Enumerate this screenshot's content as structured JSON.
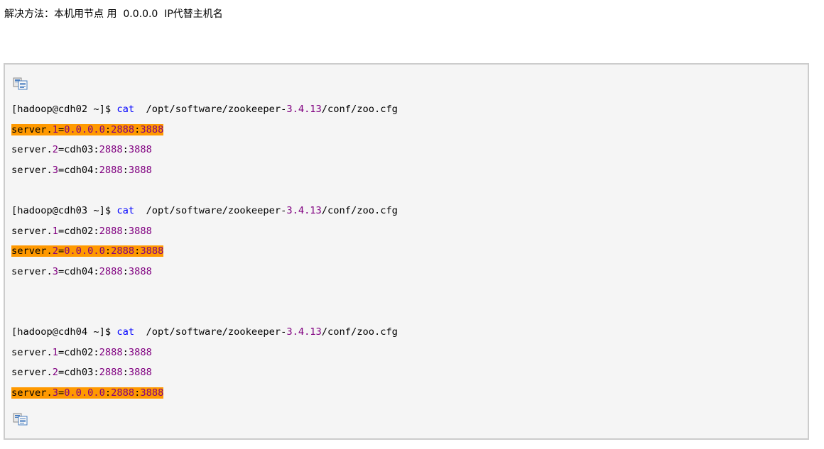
{
  "intro": "解决方法：本机用节点 用  0.0.0.0  IP代替主机名",
  "copy_icon": {
    "name": "copy-code-icon",
    "colors": [
      "#4a7fc1",
      "#c0c0c0"
    ]
  },
  "colors": {
    "highlight": "#ff9900",
    "keyword": "#0000ff",
    "number": "#800080",
    "box_bg": "#f5f5f5",
    "box_border": "#cccccc"
  },
  "lines": [
    {
      "prompt": "[hadoop@cdh02 ~]$ ",
      "cmd": "cat",
      "path_a": "  /opt/software/zookeeper-",
      "ver": "3.4.13",
      "path_b": "/conf/zoo.cfg"
    },
    {
      "s_a": "server.",
      "idx": "1",
      "s_b": "=",
      "host": "0.0.0.0",
      "sep1": ":",
      "p1": "2888",
      "sep2": ":",
      "p2": "3888",
      "highlight": true
    },
    {
      "s_a": "server.",
      "idx": "2",
      "s_b": "=cdh03:",
      "p1": "2888",
      "sep2": ":",
      "p2": "3888",
      "highlight": false
    },
    {
      "s_a": "server.",
      "idx": "3",
      "s_b": "=cdh04:",
      "p1": "2888",
      "sep2": ":",
      "p2": "3888",
      "highlight": false
    },
    {
      "prompt": "[hadoop@cdh03 ~]$ ",
      "cmd": "cat",
      "path_a": "  /opt/software/zookeeper-",
      "ver": "3.4.13",
      "path_b": "/conf/zoo.cfg"
    },
    {
      "s_a": "server.",
      "idx": "1",
      "s_b": "=cdh02:",
      "p1": "2888",
      "sep2": ":",
      "p2": "3888",
      "highlight": false
    },
    {
      "s_a": "server.",
      "idx": "2",
      "s_b": "=",
      "host": "0.0.0.0",
      "sep1": ":",
      "p1": "2888",
      "sep2": ":",
      "p2": "3888",
      "highlight": true
    },
    {
      "s_a": "server.",
      "idx": "3",
      "s_b": "=cdh04:",
      "p1": "2888",
      "sep2": ":",
      "p2": "3888",
      "highlight": false
    },
    {
      "prompt": "[hadoop@cdh04 ~]$ ",
      "cmd": "cat",
      "path_a": "  /opt/software/zookeeper-",
      "ver": "3.4.13",
      "path_b": "/conf/zoo.cfg"
    },
    {
      "s_a": "server.",
      "idx": "1",
      "s_b": "=cdh02:",
      "p1": "2888",
      "sep2": ":",
      "p2": "3888",
      "highlight": false
    },
    {
      "s_a": "server.",
      "idx": "2",
      "s_b": "=cdh03:",
      "p1": "2888",
      "sep2": ":",
      "p2": "3888",
      "highlight": false
    },
    {
      "s_a": "server.",
      "idx": "3",
      "s_b": "=",
      "host": "0.0.0.0",
      "sep1": ":",
      "p1": "2888",
      "sep2": ":",
      "p2": "3888",
      "highlight": true
    }
  ]
}
